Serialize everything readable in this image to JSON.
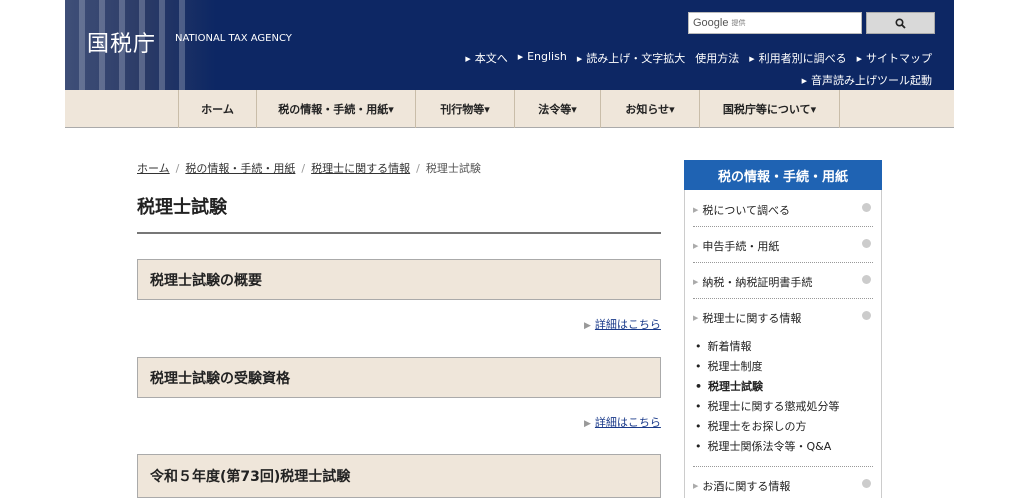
{
  "header": {
    "logo": "国税庁",
    "logo_en": "NATIONAL TAX AGENCY",
    "search_brand": "Google",
    "search_brand_sub": "提供",
    "search_button_icon": "search-icon",
    "links": [
      "本文へ",
      "English",
      "読み上げ・文字拡大",
      "使用方法",
      "利用者別に調べる",
      "サイトマップ"
    ],
    "voice_link": "音声読み上げツール起動"
  },
  "nav": {
    "items": [
      "ホーム",
      "税の情報・手続・用紙",
      "刊行物等",
      "法令等",
      "お知らせ",
      "国税庁等について"
    ]
  },
  "breadcrumb": [
    "ホーム",
    "税の情報・手続・用紙",
    "税理士に関する情報",
    "税理士試験"
  ],
  "main": {
    "title": "税理士試験",
    "sections": [
      "税理士試験の概要",
      "税理士試験の受験資格",
      "令和５年度(第73回)税理士試験"
    ],
    "detail_link": "詳細はこちら"
  },
  "sidebar": {
    "heading": "税の情報・手続・用紙",
    "items": [
      "税について調べる",
      "申告手続・用紙",
      "納税・納税証明書手続",
      "税理士に関する情報",
      "お酒に関する情報"
    ],
    "subitems": [
      "新着情報",
      "税理士制度",
      "税理士試験",
      "税理士に関する懲戒処分等",
      "税理士をお探しの方",
      "税理士関係法令等・Q&A"
    ],
    "current_subitem": "税理士試験"
  },
  "colors": {
    "header_bg": "#0d2764",
    "nav_bg": "#efe6da",
    "side_head_bg": "#1f63b3"
  }
}
